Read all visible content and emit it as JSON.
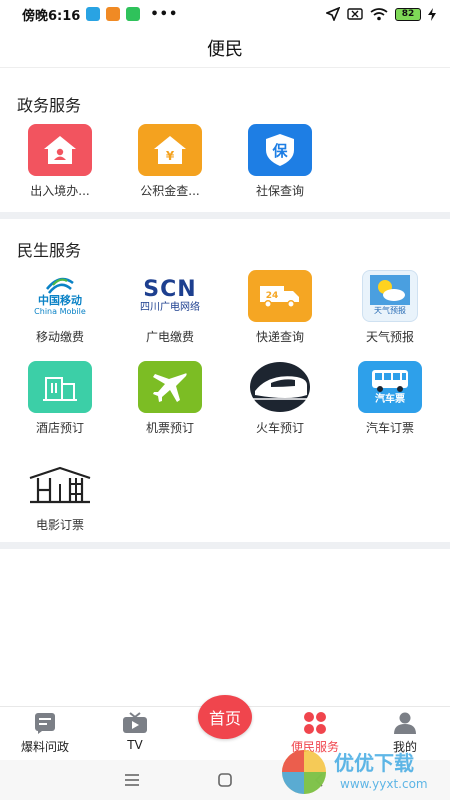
{
  "status": {
    "time": "傍晚6:16",
    "dots": "•••",
    "battery": "82"
  },
  "header": {
    "title": "便民"
  },
  "gov": {
    "title": "政务服务",
    "items": [
      {
        "label": "出入境办...",
        "icon": "house-person-icon",
        "color": "#f2545f"
      },
      {
        "label": "公积金查...",
        "icon": "house-yuan-icon",
        "color": "#f4a21f"
      },
      {
        "label": "社保查询",
        "icon": "shield-bao-icon",
        "color": "#1e7ee4"
      }
    ]
  },
  "life": {
    "title": "民生服务",
    "items": [
      {
        "label": "移动缴费",
        "icon": "china-mobile-logo",
        "logo_cn": "中国移动",
        "logo_en": "China Mobile"
      },
      {
        "label": "广电缴费",
        "icon": "scn-logo",
        "logo_mark": "SCN",
        "logo_cn": "四川广电网络"
      },
      {
        "label": "快递查询",
        "icon": "delivery-truck-icon",
        "badge": "24"
      },
      {
        "label": "天气预报",
        "icon": "weather-icon",
        "badge": "天气预报"
      },
      {
        "label": "酒店预订",
        "icon": "hotel-building-icon"
      },
      {
        "label": "机票预订",
        "icon": "airplane-icon"
      },
      {
        "label": "火车预订",
        "icon": "train-icon"
      },
      {
        "label": "汽车订票",
        "icon": "bus-icon",
        "badge": "汽车票"
      },
      {
        "label": "电影订票",
        "icon": "cinema-icon"
      }
    ]
  },
  "tabbar": {
    "items": [
      {
        "label": "爆料问政",
        "icon": "report-icon"
      },
      {
        "label": "TV",
        "icon": "tv-icon"
      },
      {
        "label": "首页",
        "icon": "home-circle"
      },
      {
        "label": "便民服务",
        "icon": "clover-icon",
        "active": true
      },
      {
        "label": "我的",
        "icon": "user-icon"
      }
    ]
  },
  "colors": {
    "accent": "#f0454d",
    "separator": "#eef0f3"
  }
}
